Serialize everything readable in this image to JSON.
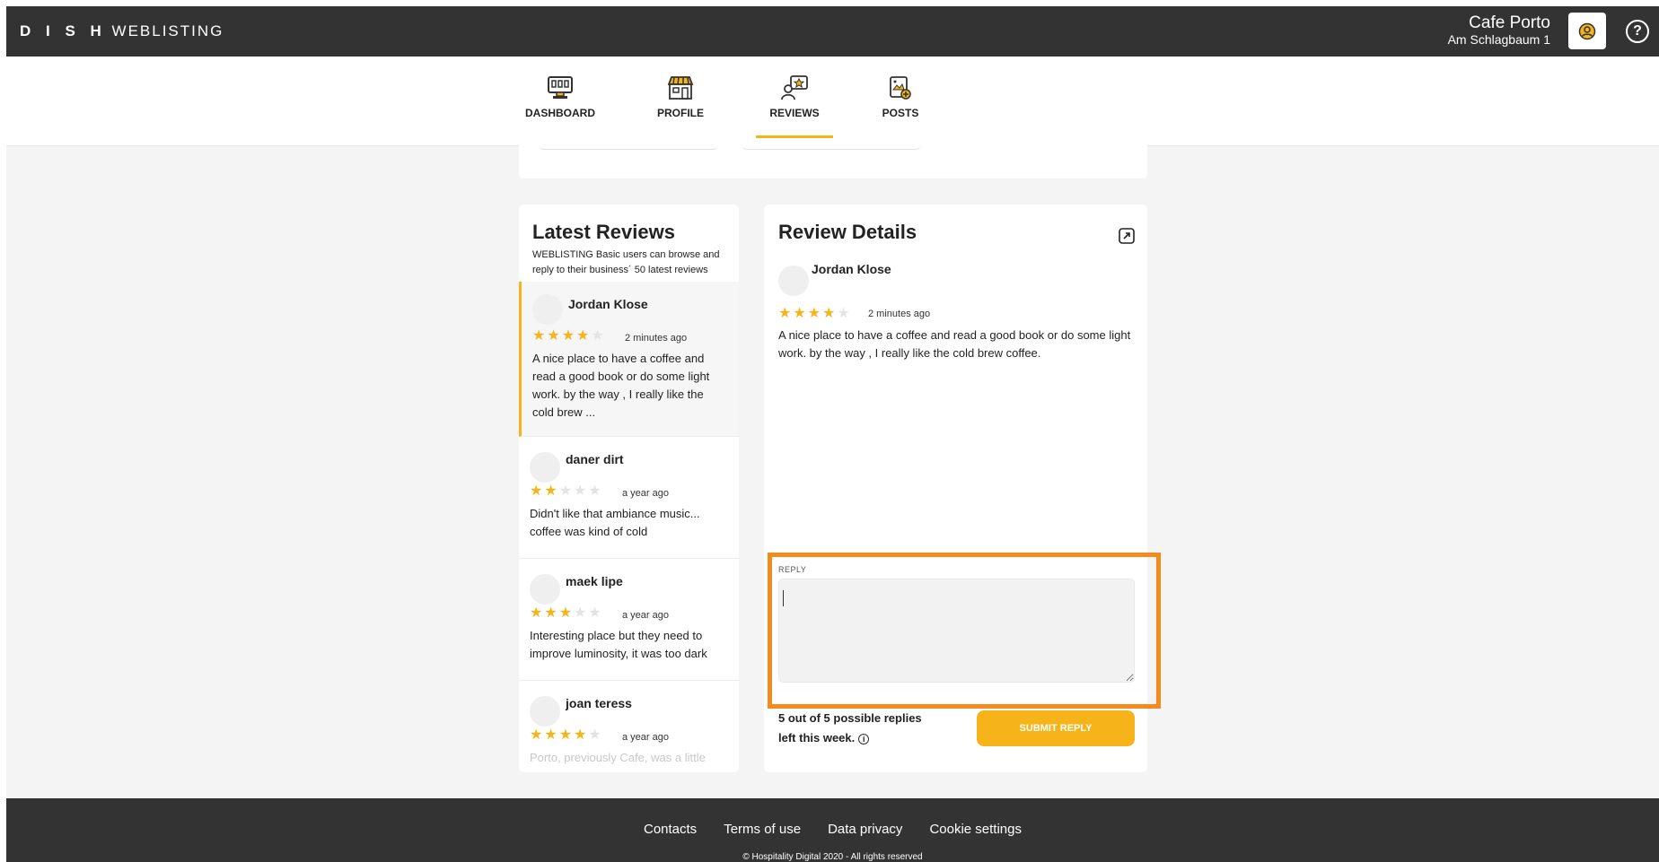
{
  "header": {
    "brand_strong": "D I S H",
    "brand_light": "WEBLISTING",
    "business_name": "Cafe Porto",
    "business_address": "Am Schlagbaum 1"
  },
  "nav": [
    {
      "label": "DASHBOARD",
      "icon": "dashboard-icon"
    },
    {
      "label": "PROFILE",
      "icon": "storefront-icon"
    },
    {
      "label": "REVIEWS",
      "icon": "reviews-icon",
      "active": true
    },
    {
      "label": "POSTS",
      "icon": "posts-icon"
    }
  ],
  "latest": {
    "title": "Latest Reviews",
    "subtitle": "WEBLISTING Basic users can browse and reply to their business´ 50 latest reviews",
    "reviews": [
      {
        "name": "Jordan Klose",
        "rating": 4,
        "time": "2 minutes ago",
        "text": "A nice place to have a coffee and read a good book or do some light work. by the way , I really like the cold brew ..."
      },
      {
        "name": "daner dirt",
        "rating": 2,
        "time": "a year ago",
        "text": "Didn't like that ambiance music... coffee was kind of cold"
      },
      {
        "name": "maek lipe",
        "rating": 3,
        "time": "a year ago",
        "text": "Interesting place but they need to improve luminosity, it was too dark"
      },
      {
        "name": "joan teress",
        "rating": 4,
        "time": "a year ago",
        "text": "Porto, previously Cafe, was a little"
      }
    ]
  },
  "details": {
    "title": "Review Details",
    "name": "Jordan Klose",
    "rating": 4,
    "time": "2 minutes ago",
    "text": "A nice place to have a coffee and read a good book or do some light work. by the way , I really like the cold brew coffee.",
    "reply_label": "REPLY",
    "reply_value": "",
    "replies_left": "5 out of 5 possible replies left this week.",
    "submit_label": "SUBMIT REPLY"
  },
  "footer": {
    "links": [
      "Contacts",
      "Terms of use",
      "Data privacy",
      "Cookie settings"
    ],
    "copyright": "© Hospitality Digital 2020 - All rights reserved"
  },
  "colors": {
    "accent": "#f5b41a",
    "highlight": "#f58a1f",
    "dark": "#333333"
  }
}
